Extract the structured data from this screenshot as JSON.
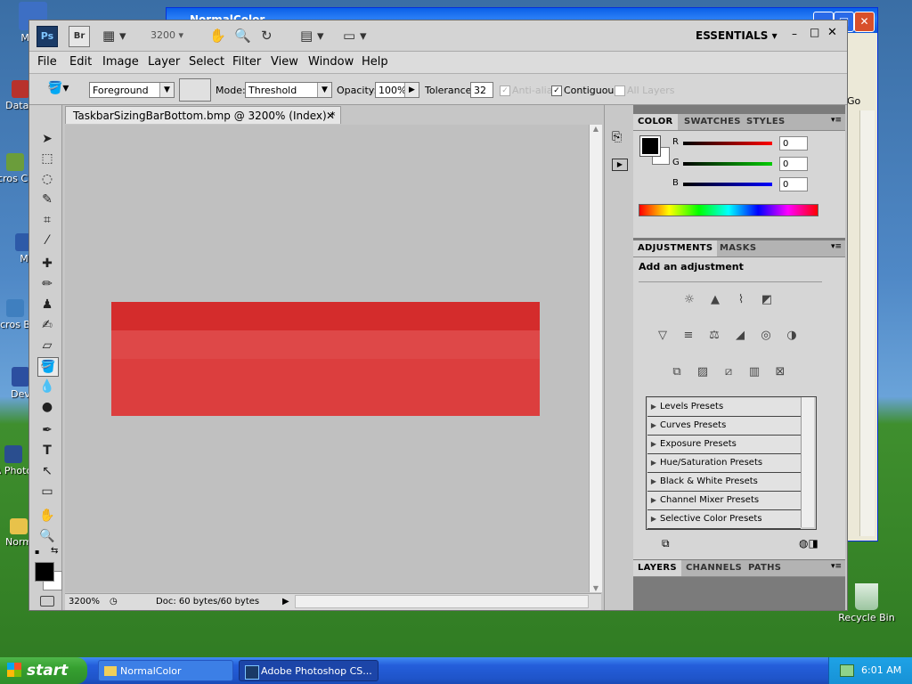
{
  "desktop": {
    "icons": [
      {
        "label": "My C",
        "color": "#3d6fc4"
      },
      {
        "label": "DataV",
        "color": "#b8322c"
      },
      {
        "label": "Micros C++",
        "color": "#6b9d3b"
      },
      {
        "label": "M",
        "color": "#2d5aa8"
      },
      {
        "label": "Micros Bas",
        "color": "#3f7fbf"
      },
      {
        "label": "Dev",
        "color": "#2c4fa0"
      },
      {
        "label": "A Photo",
        "color": "#2a4e8f"
      },
      {
        "label": "Norm",
        "color": "#e8c24a"
      }
    ],
    "recycle_bin": "Recycle Bin"
  },
  "bg_window": {
    "title": "NormalColor",
    "side_label": "Go"
  },
  "ps": {
    "app_icon": "Ps",
    "bridge_icon": "Br",
    "zoom": "3200",
    "workspace": "ESSENTIALS",
    "menu": [
      "File",
      "Edit",
      "Image",
      "Layer",
      "Select",
      "Filter",
      "View",
      "Window",
      "Help"
    ],
    "options": {
      "fill_source": "Foreground",
      "mode_label": "Mode:",
      "mode": "Threshold",
      "opacity_label": "Opacity:",
      "opacity": "100%",
      "tolerance_label": "Tolerance:",
      "tolerance": "32",
      "anti_alias": "Anti-alias",
      "contiguous": "Contiguous",
      "all_layers": "All Layers"
    },
    "document": {
      "tab": "TaskbarSizingBarBottom.bmp @ 3200% (Index) *",
      "zoom_status": "3200%",
      "doc_info": "Doc: 60 bytes/60 bytes",
      "colors": {
        "top_band": "#d42c2c",
        "body": "#dc3e3e",
        "mid_band": "#de4848"
      }
    },
    "color_panel": {
      "tabs": [
        "COLOR",
        "SWATCHES",
        "STYLES"
      ],
      "r_label": "R",
      "g_label": "G",
      "b_label": "B",
      "r": "0",
      "g": "0",
      "b": "0"
    },
    "adjustments_panel": {
      "tabs": [
        "ADJUSTMENTS",
        "MASKS"
      ],
      "heading": "Add an adjustment",
      "presets": [
        "Levels Presets",
        "Curves Presets",
        "Exposure Presets",
        "Hue/Saturation Presets",
        "Black & White Presets",
        "Channel Mixer Presets",
        "Selective Color Presets"
      ]
    },
    "layers_panel": {
      "tabs": [
        "LAYERS",
        "CHANNELS",
        "PATHS"
      ]
    }
  },
  "taskbar": {
    "start": "start",
    "tasks": [
      "NormalColor",
      "Adobe Photoshop CS..."
    ],
    "clock": "6:01 AM"
  }
}
